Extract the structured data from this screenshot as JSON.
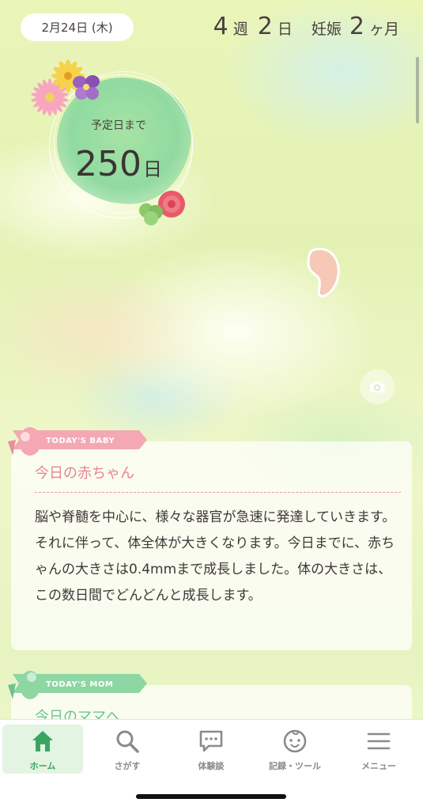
{
  "header": {
    "date": "2月24日 (木)",
    "weeks": "4",
    "weeks_unit": "週",
    "days": "2",
    "days_unit": "日",
    "pregnancy_label": "妊娠",
    "months": "2",
    "months_unit": "ヶ月"
  },
  "countdown": {
    "label": "予定日まで",
    "value": "250",
    "unit": "日"
  },
  "today_baby": {
    "ribbon": "TODAY'S BABY",
    "title": "今日の赤ちゃん",
    "body": "脳や脊髄を中心に、様々な器官が急速に発達していきます。それに伴って、体全体が大きくなります。今日までに、赤ちゃんの大きさは0.4mmまで成長しました。体の大きさは、この数日間でどんどんと成長します。"
  },
  "today_mom": {
    "ribbon": "TODAY'S MOM",
    "title": "今日のママへ"
  },
  "tabs": [
    {
      "label": "ホーム",
      "icon": "home-icon",
      "active": true
    },
    {
      "label": "さがす",
      "icon": "search-icon",
      "active": false
    },
    {
      "label": "体験談",
      "icon": "chat-bubble-icon",
      "active": false
    },
    {
      "label": "記録・ツール",
      "icon": "baby-face-icon",
      "active": false
    },
    {
      "label": "メニュー",
      "icon": "menu-icon",
      "active": false
    }
  ],
  "colors": {
    "accent_green": "#3aa563",
    "baby_pink": "#e8868f",
    "mom_green": "#6cc48e"
  }
}
